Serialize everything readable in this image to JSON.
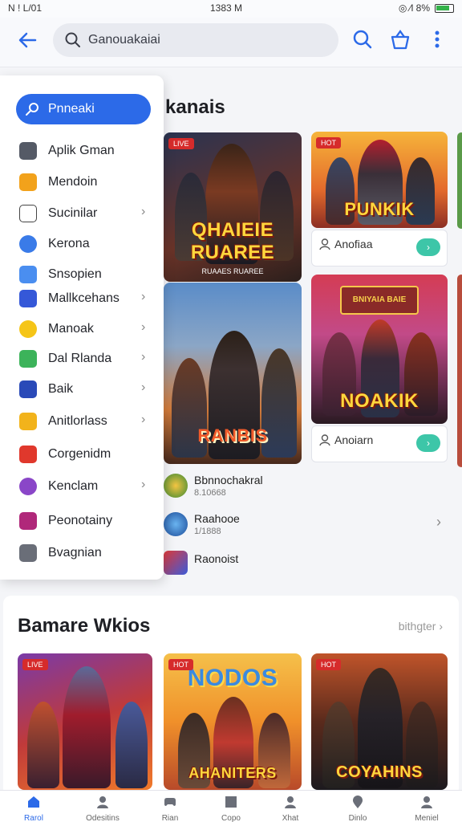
{
  "status_bar": {
    "left": "N ! L/01",
    "time": "1383 M",
    "right": "◎ ⁄l  8%"
  },
  "search": {
    "value": "Ganouakaiai"
  },
  "sidebar": {
    "primary": "Pnneaki",
    "items": [
      {
        "label": "Aplik Gman",
        "icon": "gear-icon",
        "color": "#555a66",
        "chevron": false
      },
      {
        "label": "Mendoin",
        "icon": "folder-icon",
        "color": "#f2a21b",
        "chevron": false
      },
      {
        "label": "Sucinilar",
        "icon": "square-icon",
        "color": "#ffffff",
        "chevron": true
      },
      {
        "label": "Kerona",
        "icon": "circle-icon",
        "color": "#3a7be8",
        "chevron": false
      },
      {
        "label": "Snsopien",
        "icon": "window-icon",
        "color": "#4a8ef0",
        "chevron": false
      },
      {
        "label": "Mallkcehans",
        "icon": "map-icon",
        "color": "#3558d8",
        "chevron": true
      },
      {
        "label": "Manoak",
        "icon": "coin-icon",
        "color": "#f5c518",
        "chevron": true
      },
      {
        "label": "Dal Rlanda",
        "icon": "leaf-icon",
        "color": "#3cb35a",
        "chevron": true
      },
      {
        "label": "Baik",
        "icon": "pin-icon",
        "color": "#2a4ab8",
        "chevron": true
      },
      {
        "label": "Anitlorlass",
        "icon": "cross-icon",
        "color": "#f2b31b",
        "chevron": true
      },
      {
        "label": "Corgenidm",
        "icon": "chat-icon",
        "color": "#e0382c",
        "chevron": false
      },
      {
        "label": "Kenclam",
        "icon": "globe-icon",
        "color": "#8a46c8",
        "chevron": true
      },
      {
        "label": "Peonotainy",
        "icon": "x-box-icon",
        "color": "#b0287a",
        "chevron": false
      },
      {
        "label": "Bvagnian",
        "icon": "tool-icon",
        "color": "#6a6e78",
        "chevron": false
      }
    ]
  },
  "main": {
    "title": "kanais",
    "tiles": [
      {
        "badge": "LIVE",
        "art_title": "QHAIEIE RUAREE",
        "art_sub": "RUAAES RUAREE"
      },
      {
        "badge": "HOT",
        "art_title": "PUNKIK",
        "art_sub": ""
      },
      {
        "badge": "",
        "art_title": "RANBIS",
        "art_sub": ""
      },
      {
        "badge": "",
        "art_title": "NOAKIK",
        "art_sub": "BNIYAIA BAIE"
      }
    ],
    "cards": [
      {
        "label": "Anofiaa",
        "go": "›"
      },
      {
        "label": "Anoiarn",
        "go": "›"
      }
    ],
    "rows": [
      {
        "title": "Bbnnochakral",
        "sub": "8.10668"
      },
      {
        "title": "Raahooe",
        "sub": "1/1888"
      },
      {
        "title": "Raonoist",
        "sub": ""
      }
    ]
  },
  "section2": {
    "title": "Bamare Wkios",
    "more": "bithgter ›",
    "tiles": [
      {
        "badge": "LIVE",
        "art_title": ""
      },
      {
        "badge": "HOT",
        "art_title": "NODOS",
        "art_sub": "AHANITERS"
      },
      {
        "badge": "HOT",
        "art_title": "COYAHINS"
      }
    ]
  },
  "bottom_nav": [
    {
      "label": "Rarol",
      "icon": "home-icon",
      "active": true
    },
    {
      "label": "Odesitins",
      "icon": "person-icon"
    },
    {
      "label": "Rian",
      "icon": "gamepad-icon"
    },
    {
      "label": "Copo",
      "icon": "square-icon"
    },
    {
      "label": "Xhat",
      "icon": "user-icon"
    },
    {
      "label": "Dinlo",
      "icon": "location-icon"
    },
    {
      "label": "Meniel",
      "icon": "profile-icon"
    }
  ]
}
